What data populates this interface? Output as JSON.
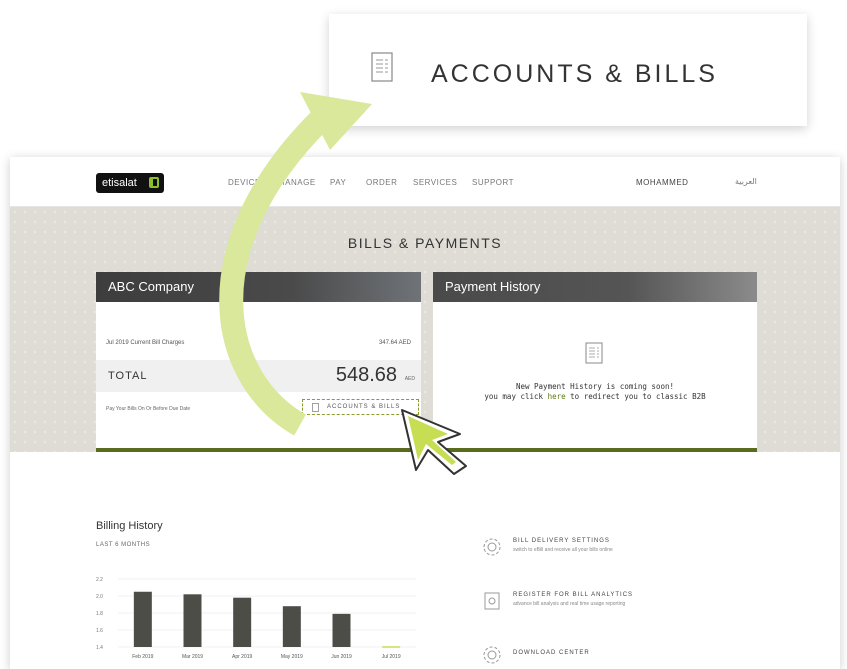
{
  "callout": {
    "label": "ACCOUNTS & BILLS"
  },
  "nav": {
    "items": [
      "DEVICES",
      "MANAGE",
      "PAY",
      "ORDER",
      "SERVICES",
      "SUPPORT"
    ],
    "user": "MOHAMMED",
    "language": "العربية",
    "logo_text": "etisalat"
  },
  "page": {
    "title": "BILLS & PAYMENTS"
  },
  "bill_panel": {
    "header": "ABC Company",
    "charges_label": "Jul 2019  Current Bill Charges",
    "charges_amount": "347.64 AED",
    "total_label": "TOTAL",
    "total_value": "548.68",
    "currency": "AED",
    "due_text": "Pay Your Bills On Or Before Due Date",
    "accounts_link": "ACCOUNTS & BILLS"
  },
  "payment_panel": {
    "header": "Payment History",
    "line1": "New Payment History is coming soon!",
    "line2_pre": "you may click ",
    "line2_link": "here",
    "line2_post": " to redirect you to classic B2B"
  },
  "billing_history": {
    "title": "Billing History",
    "subtitle": "LAST 6 MONTHS"
  },
  "features": [
    {
      "title": "BILL DELIVERY SETTINGS",
      "desc": "switch to eBill and receive all your bills online",
      "icon": "gear-icon"
    },
    {
      "title": "REGISTER FOR BILL ANALYTICS",
      "desc": "advance bill analysis and real time usage reporting",
      "icon": "analytics-icon"
    },
    {
      "title": "DOWNLOAD CENTER",
      "desc": "",
      "icon": "gear-icon"
    }
  ],
  "colors": {
    "accent_green": "#5b6b1e",
    "arrow": "#d9e89a",
    "bar": "#4d4d48"
  },
  "chart_data": {
    "type": "bar",
    "categories": [
      "Feb 2019",
      "Mar 2019",
      "Apr 2019",
      "May 2019",
      "Jun 2019",
      "Jul 2019"
    ],
    "values": [
      2.05,
      2.02,
      1.98,
      1.88,
      1.79,
      1.4
    ],
    "yticks": [
      "2.2",
      "2.0",
      "1.8",
      "1.6",
      "1.4"
    ],
    "ylim": [
      1.4,
      2.2
    ],
    "grid": true
  }
}
